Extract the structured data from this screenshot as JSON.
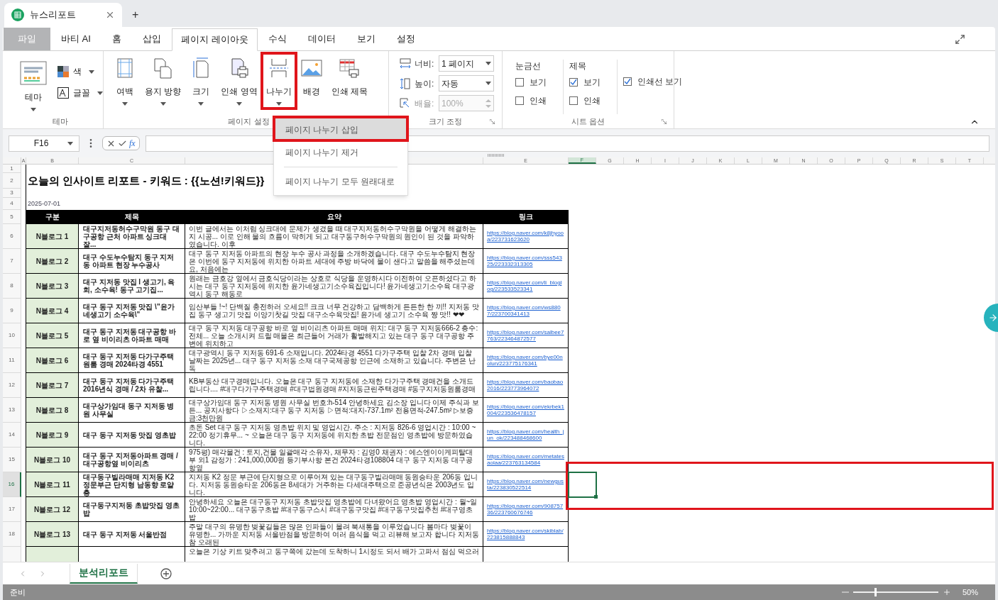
{
  "window": {
    "tab_title": "뉴스리포트",
    "new_tab": "+"
  },
  "menu_tabs": [
    {
      "label": "파일",
      "kind": "file",
      "selected": false
    },
    {
      "label": "바티 AI",
      "kind": "tab",
      "selected": false
    },
    {
      "label": "홈",
      "kind": "tab",
      "selected": false
    },
    {
      "label": "삽입",
      "kind": "tab",
      "selected": false
    },
    {
      "label": "페이지 레이아웃",
      "kind": "tab",
      "selected": true
    },
    {
      "label": "수식",
      "kind": "tab",
      "selected": false
    },
    {
      "label": "데이터",
      "kind": "tab",
      "selected": false
    },
    {
      "label": "보기",
      "kind": "tab",
      "selected": false
    },
    {
      "label": "설정",
      "kind": "tab",
      "selected": false
    }
  ],
  "ribbon": {
    "groups": [
      {
        "kind": "theme",
        "label": "테마",
        "items": [
          {
            "label": "테마",
            "dropdown": true
          },
          {
            "label": "색",
            "dropdown": true
          },
          {
            "label": "글꼴",
            "dropdown": true
          }
        ]
      },
      {
        "kind": "buttons",
        "label": "페이지 설정",
        "items": [
          {
            "label": "여백",
            "dropdown": true,
            "highlighted": false
          },
          {
            "label": "용지 방향",
            "dropdown": true,
            "highlighted": false
          },
          {
            "label": "크기",
            "dropdown": true,
            "highlighted": false
          },
          {
            "label": "인쇄 영역",
            "dropdown": true,
            "highlighted": false
          },
          {
            "label": "나누기",
            "dropdown": true,
            "highlighted": true
          },
          {
            "label": "배경",
            "dropdown": false,
            "highlighted": false
          },
          {
            "label": "인쇄 제목",
            "dropdown": false,
            "highlighted": false
          }
        ]
      },
      {
        "kind": "scale",
        "label": "크기 조정",
        "fields": [
          {
            "label": "너비:",
            "value": "1 페이지",
            "disabled": false
          },
          {
            "label": "높이:",
            "value": "자동",
            "disabled": false
          },
          {
            "label": "배율:",
            "value": "100%",
            "disabled": true
          }
        ]
      },
      {
        "kind": "sheet_options",
        "label": "시트 옵션",
        "columns": [
          {
            "heading": "눈금선",
            "options": [
              {
                "label": "보기",
                "checked": false
              },
              {
                "label": "인쇄",
                "checked": false
              }
            ]
          },
          {
            "heading": "제목",
            "options": [
              {
                "label": "보기",
                "checked": true
              },
              {
                "label": "인쇄",
                "checked": false
              }
            ]
          }
        ],
        "extra": {
          "label": "인쇄선 보기",
          "checked": true
        }
      }
    ]
  },
  "break_menu": {
    "items": [
      {
        "label": "페이지 나누기 삽입",
        "hovered": true,
        "highlighted": true
      },
      {
        "label": "페이지 나누기 제거",
        "hovered": false,
        "highlighted": false
      },
      {
        "label": "페이지 나누기 모두 원래대로",
        "hovered": false,
        "highlighted": false
      }
    ]
  },
  "formula_bar": {
    "name_box": "F16",
    "fx": "fx"
  },
  "sheet": {
    "columns": [
      {
        "letter": "A",
        "selected": false
      },
      {
        "letter": "B",
        "selected": false
      },
      {
        "letter": "C",
        "selected": false
      },
      {
        "selected": false
      },
      {
        "letter": "E",
        "selected": false
      },
      {
        "letter": "F",
        "selected": true
      },
      {
        "letter": "G",
        "selected": false
      },
      {
        "letter": "H",
        "selected": false
      },
      {
        "letter": "I",
        "selected": false
      },
      {
        "letter": "J",
        "selected": false
      },
      {
        "letter": "K",
        "selected": false
      },
      {
        "letter": "L",
        "selected": false
      },
      {
        "letter": "M",
        "selected": false
      },
      {
        "letter": "N",
        "selected": false
      },
      {
        "letter": "O",
        "selected": false
      },
      {
        "letter": "P",
        "selected": false
      },
      {
        "letter": "Q",
        "selected": false
      },
      {
        "letter": "R",
        "selected": false
      },
      {
        "letter": "S",
        "selected": false
      },
      {
        "letter": "T",
        "selected": false
      }
    ],
    "rows": [
      {
        "number": "1",
        "selected": false
      },
      {
        "number": "2",
        "selected": false
      },
      {
        "number": "3",
        "selected": false
      },
      {
        "number": "4",
        "selected": false
      },
      {
        "number": "5",
        "selected": false
      },
      {
        "number": "6",
        "selected": false
      },
      {
        "number": "7",
        "selected": false
      },
      {
        "number": "8",
        "selected": false
      },
      {
        "number": "9",
        "selected": false
      },
      {
        "number": "10",
        "selected": false
      },
      {
        "number": "11",
        "selected": false
      },
      {
        "number": "12",
        "selected": false
      },
      {
        "number": "13",
        "selected": false
      },
      {
        "number": "14",
        "selected": false
      },
      {
        "number": "15",
        "selected": false
      },
      {
        "number": "16",
        "selected": true
      },
      {
        "number": "17",
        "selected": false
      },
      {
        "number": "18",
        "selected": false
      }
    ],
    "selection_highlighted": true
  },
  "report": {
    "title": "오늘의 인사이트 리포트 - 키워드 : {{노션!키워드}}",
    "date": "2025-07-01",
    "headers": [
      "구분",
      "제목",
      "요약",
      "링크"
    ],
    "entries": [
      {
        "category": "N블로그 1",
        "title": "대구지저동허수구막원 동구 대구공항 근처 아파트 싱크대 잘...",
        "summary": "이번 글에서는 이처럼 싱크대에 문제가 생겼을 때 대구지저동허수구막원을 어떻게 해결하는지 시공... 이로 인해 물의 흐름이 막히게 되고 대구동구허수구막원의 원인이 된 것을 파악하였습니다. 이후",
        "link": "https://blog.naver.com/k8jhyooa/223731623620"
      },
      {
        "category": "N블로그 2",
        "title": "대구 수도누수탐지 동구 지저동 아파트 현장 누수공사",
        "summary": "대구 동구 지저동 아파트의 현장 누수 공사 과정을 소개하겠습니다. 대구 수도누수탐지 현장은 이번에 동구 지저동에 위치한 아파트 세대에 주방 바닥에 물이 샌다고 말씀을 해주셨는데요, 처음에는",
        "link": "https://blog.naver.com/sss54325/223332313305"
      },
      {
        "category": "N블로그 3",
        "title": "대구 지저동 맛집 l 생고기, 육회, 소수육! 동구 고기집...",
        "summary": "원래는 금호강 옆에서 금호식당이라는 상호로 식당을 운영하시다 이전하여 오픈하셨다고 하시는 대구 동구 지저동에 위치한 윤가네생고기소수육집입니다! 윤가네생고기소수육 대구광역시 동구 해동로",
        "link": "https://blog.naver.com/li_bloglog/223533523341"
      },
      {
        "category": "N블로그 4",
        "title": "대구 동구 지저동 맛집 \\\"윤가네생고기 소수육\\\"",
        "summary": "임산부들 !~! 단백질 충전하러 오세요!! 크크 너무 건강하고 담백하게 든든한 한 끼!! 지저동 맛집 동구 생고기 맛집 이양기찻길 맛집 대구소수육맛집! 윤가네 생고기 소수육 쨩 맛!! ❤❤",
        "link": "https://blog.naver.com/ws8807/223700341413"
      },
      {
        "category": "N블로그 5",
        "title": "대구 동구 지저동 대구공항 바로 옆 비이리츠 아파트 매매",
        "summary": "대구 동구 지저동 대구공항 바로 옆 비이리츠 아파트 매매 위치: 대구 동구 지저동666-2 층수: 전체... 오늘 소개시켜 드릴 매물은 최근들어 거래가 활발해지고 있는 대구 동구 대구공항 주변에 위치하고",
        "link": "https://blog.naver.com/salbee7763/223464872577"
      },
      {
        "category": "N블로그 6",
        "title": "대구 동구 지저동 다가구주택 원룸 경매 2024타경 4551",
        "summary": "대구광역시 동구 지저동 691-6 소재입니다. 2024타경 4551 다가구주택 입찰 2차 경매 입찰 날짜는 2025년... 대구 동구 지저동 소재 대구국제공항 인근에 소재하고 있습니다. 주변은 난독",
        "link": "https://blog.naver.com/bye00nolun/223775176341"
      },
      {
        "category": "N블로그 7",
        "title": "대구 동구 지저동 다가구주택 2016년식 경매 / 2차 유찰...",
        "summary": "KB부동산 대구경매입니다. 오늘은 대구 동구 지저동에 소재한 다가구주택 경매건을 소개드립니다.... #대구다가구주택경매 #대구법원경매 #지저동근린주택경매 #동구지저동원룸경매",
        "link": "https://blog.naver.com/baobao2016/223773964072"
      },
      {
        "category": "N블로그 8",
        "title": "대구상가임대 동구 지저동 병원 사무실",
        "summary": "대구상가임대 동구 지저동 병원 사무실 번호:h-514 안녕하세요 김소장 입니다 이제 주식과 보든... 공지사항다 ▷소재지:대구 동구 지저동 ▷면적:대지-737.1m² 전용면적-247.5m² ▷보증금:3천만원",
        "link": "https://blog.naver.com/ekrbek1004/223536478157"
      },
      {
        "category": "N블로그 9",
        "title": "대구 동구 지저동 맛집 영초밥",
        "summary": "초돈 Set 대구 동구 지저동 영초밥 위치 및 영업시간. 주소 : 지저동 826-6 영업시간 : 10:00 ~ 22:00 정기휴무... ~ 오늘은 대구 동구 지저동에 위치한 초밥 전문점인 영초밥에 방문하였습니다.",
        "link": "https://blog.naver.com/health_jun_ok/223488468600"
      },
      {
        "category": "N블로그 10",
        "title": "대구 동구 지저동아파트 경매 / 대구공항옆 비이리츠",
        "summary": "975평) 매각물건 : 토지,건물 일괄매각 소유자, 채무자 : 김영0 채권자 : 에스엔이이케피탈대부 외1 감정가 : 241,000,000원 등기부사항 본건 2024타경108804 대구 동구 지저동 대구공항옆",
        "link": "https://blog.naver.com/metatesaolaa/223763134584"
      },
      {
        "category": "N블로그 11",
        "title": "대구동구빌라매매 지저동 K2 정문부근 단지형 남동향 로얄층",
        "summary": "지저동 K2 정문 부근에 단지형으로 이루어져 있는 대구동구빌라매매 동원승타운 206동 입니다. 지저동 동원승타운 206동은 8세대가 거주하는 다세대주택으로 준공년식은 2003년도 입니다.",
        "link": "https://blog.naver.com/newgusta/223830522514"
      },
      {
        "category": "N블로그 12",
        "title": "대구동구지저동 초밥맛집 영초밥",
        "summary": "안녕하세요 오늘은 대구동구 지저동 초밥맛집 영초밥에 다녀왔어요 영초밥 영업시간 : 월~일 10:00~22:00... 대구동구초밥 #대구동구스시 #대구동구맛집 #대구동구맛집추천 #대구영초밥",
        "link": "https://blog.naver.com/90875736/223760676746"
      },
      {
        "category": "N블로그 13",
        "title": "대구 동구 지저동 서울반점",
        "summary": "주말 대구의 유명한 벚꽃길들은 많은 인파들이 몰려 북새통을 이루었습니다 봄마다 벚꽃이 유명한... 가까운 지저동 서울반점을 방문하여 여러 음식을 먹고 리뷰해 보고자 합니다 지저동 참 오래된",
        "link": "https://blog.naver.com/skiblab/223815888843"
      }
    ],
    "partial_summary": "오늘은 기상 키트 맞추려고 동구쪽에 갔는데 도착하니 1시정도 되서 배가 고파서 점심 먹으러"
  },
  "sheet_tabs": [
    {
      "label": "분석리포트",
      "selected": true
    }
  ],
  "status_bar": {
    "status": "준비",
    "zoom": {
      "level": 0.25,
      "reading": "50%"
    }
  }
}
